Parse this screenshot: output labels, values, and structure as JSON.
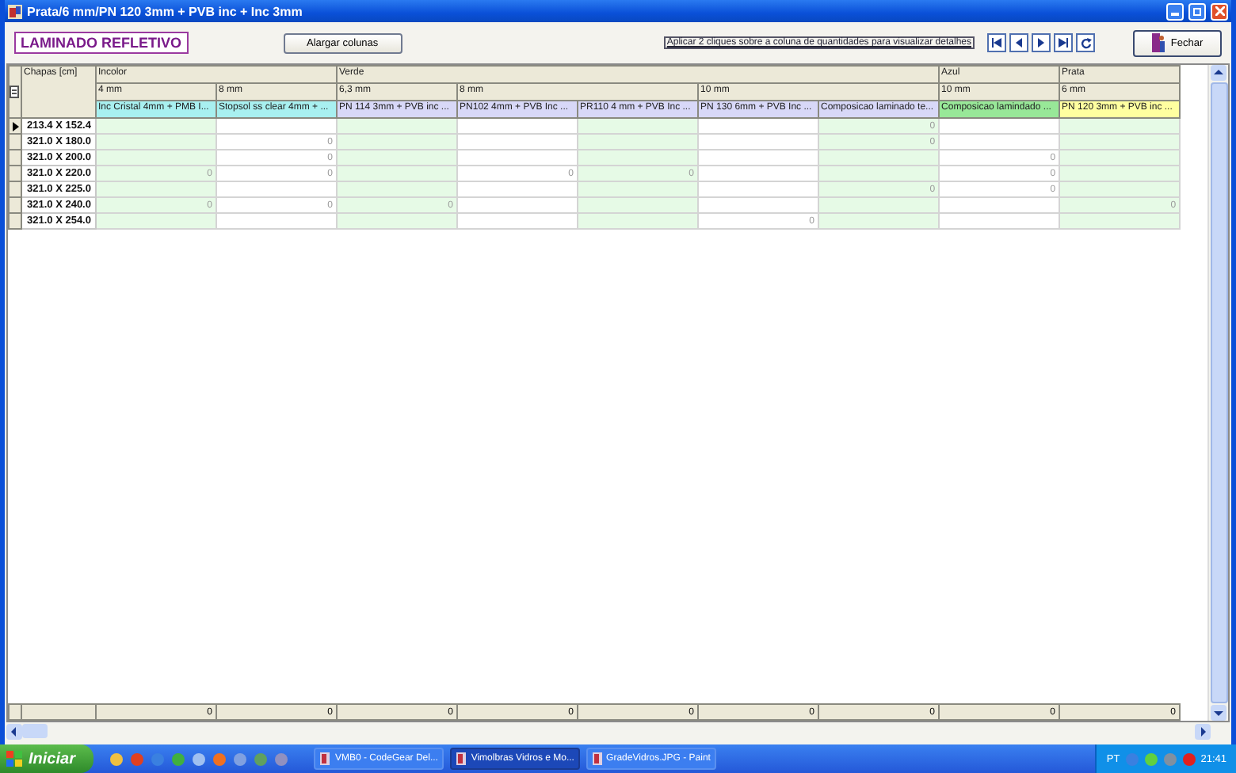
{
  "window": {
    "title": "Prata/6 mm/PN 120 3mm + PVB inc + Inc 3mm"
  },
  "toolbar": {
    "heading": "LAMINADO REFLETIVO",
    "widen_button": "Alargar colunas",
    "hint": "Aplicar 2 cliques sobre a coluna de quantidades para visualizar detalhes",
    "close_button": "Fechar"
  },
  "grid": {
    "corner_header": "Chapas [cm]",
    "groups": [
      {
        "label": "Incolor",
        "thicknesses": [
          {
            "label": "4 mm",
            "products": [
              {
                "label": "Inc Cristal 4mm + PMB I...",
                "color": "#a8f0f0"
              }
            ]
          },
          {
            "label": "8 mm",
            "products": [
              {
                "label": "Stopsol ss clear 4mm + ...",
                "color": "#a8f0f0"
              }
            ]
          }
        ]
      },
      {
        "label": "Verde",
        "thicknesses": [
          {
            "label": "6,3 mm",
            "products": [
              {
                "label": "PN 114 3mm + PVB inc ...",
                "color": "#d8d8f8"
              }
            ]
          },
          {
            "label": "8 mm",
            "products": [
              {
                "label": "PN102 4mm + PVB Inc ...",
                "color": "#d8d8f8"
              },
              {
                "label": "PR110 4 mm + PVB Inc ...",
                "color": "#d8d8f8"
              }
            ]
          },
          {
            "label": "10 mm",
            "products": [
              {
                "label": "PN 130 6mm + PVB Inc ...",
                "color": "#d8d8f8"
              },
              {
                "label": "Composicao laminado te...",
                "color": "#d8d8f8"
              }
            ]
          }
        ]
      },
      {
        "label": "Azul",
        "thicknesses": [
          {
            "label": "10 mm",
            "products": [
              {
                "label": "Composicao lamindado ...",
                "color": "#98e898"
              }
            ]
          }
        ]
      },
      {
        "label": "Prata",
        "thicknesses": [
          {
            "label": "6 mm",
            "products": [
              {
                "label": "PN 120 3mm + PVB inc ...",
                "color": "#ffffa0"
              }
            ]
          }
        ]
      }
    ],
    "rows": [
      {
        "size": "213.4 X 152.4",
        "selected": true,
        "cells": [
          null,
          null,
          null,
          null,
          null,
          null,
          "0",
          null,
          null
        ]
      },
      {
        "size": "321.0 X 180.0",
        "selected": false,
        "cells": [
          null,
          "0",
          null,
          null,
          null,
          null,
          "0",
          null,
          null
        ]
      },
      {
        "size": "321.0 X 200.0",
        "selected": false,
        "cells": [
          null,
          "0",
          null,
          null,
          null,
          null,
          null,
          "0",
          null
        ]
      },
      {
        "size": "321.0 X 220.0",
        "selected": false,
        "cells": [
          "0",
          "0",
          null,
          "0",
          "0",
          null,
          null,
          "0",
          null
        ]
      },
      {
        "size": "321.0 X 225.0",
        "selected": false,
        "cells": [
          null,
          null,
          null,
          null,
          null,
          null,
          "0",
          "0",
          null
        ]
      },
      {
        "size": "321.0 X 240.0",
        "selected": false,
        "cells": [
          "0",
          "0",
          "0",
          null,
          null,
          null,
          null,
          null,
          "0"
        ]
      },
      {
        "size": "321.0 X 254.0",
        "selected": false,
        "cells": [
          null,
          null,
          null,
          null,
          null,
          "0",
          null,
          null,
          null
        ]
      }
    ],
    "totals": [
      "0",
      "0",
      "0",
      "0",
      "0",
      "0",
      "0",
      "0",
      "0"
    ]
  },
  "taskbar": {
    "start": "Iniciar",
    "tasks": [
      {
        "label": "VMB0 - CodeGear Del...",
        "selected": false
      },
      {
        "label": "Vimolbras Vidros e Mo...",
        "selected": true
      },
      {
        "label": "GradeVidros.JPG - Paint",
        "selected": false
      }
    ],
    "language": "PT",
    "clock": "21:41"
  }
}
